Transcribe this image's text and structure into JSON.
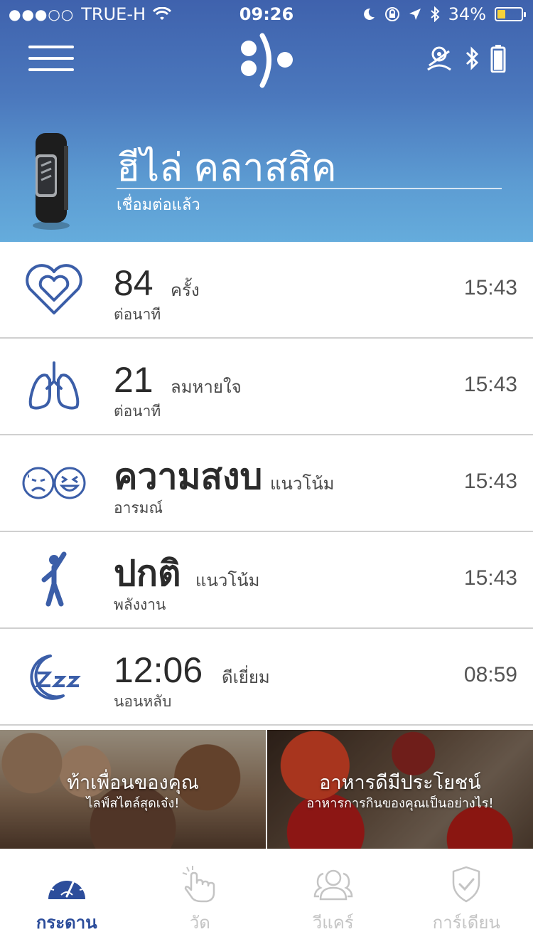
{
  "status_bar": {
    "carrier": "TRUE-H",
    "time": "09:26",
    "battery_percent": "34%",
    "battery_level": 0.34,
    "battery_color": "#f6d23a"
  },
  "header": {
    "menu_icon": "hamburger-menu-icon",
    "logo_icon": "app-logo-icon",
    "status_icons": [
      "location-pin-icon",
      "bluetooth-icon",
      "battery-icon"
    ]
  },
  "device": {
    "name": "ฮีไล่ คลาสสิค",
    "status": "เชื่อมต่อแล้ว"
  },
  "metrics": [
    {
      "icon": "heart-icon",
      "value": "84",
      "unit": "ครั้ง",
      "label": "ต่อนาที",
      "time": "15:43"
    },
    {
      "icon": "lungs-icon",
      "value": "21",
      "unit": "ลมหายใจ",
      "label": "ต่อนาที",
      "time": "15:43"
    },
    {
      "icon": "mood-faces-icon",
      "value": "ความสงบ",
      "unit": "แนวโน้ม",
      "label": "อารมณ์",
      "time": "15:43"
    },
    {
      "icon": "person-energy-icon",
      "value": "ปกติ",
      "unit": "แนวโน้ม",
      "label": "พลังงาน",
      "time": "15:43"
    },
    {
      "icon": "sleep-moon-icon",
      "value": "12:06",
      "unit": "ดีเยี่ยม",
      "label": "นอนหลับ",
      "time": "08:59"
    }
  ],
  "banners": [
    {
      "title": "ท้าเพื่อนของคุณ",
      "subtitle": "ไลฟ์สไตล์สุดเจ๋ง!"
    },
    {
      "title": "อาหารดีมีประโยชน์",
      "subtitle": "อาหารการกินของคุณเป็นอย่างไร!"
    }
  ],
  "tabs": [
    {
      "label": "กระดาน",
      "icon": "dashboard-gauge-icon",
      "active": true
    },
    {
      "label": "วัด",
      "icon": "tap-hand-icon",
      "active": false
    },
    {
      "label": "วีแคร์",
      "icon": "people-icon",
      "active": false
    },
    {
      "label": "การ์เดียน",
      "icon": "shield-check-icon",
      "active": false
    }
  ],
  "colors": {
    "primary": "#3f62ad",
    "active_tab": "#2c4d9b",
    "icon_blue": "#3b5ea8",
    "inactive": "#c4c4c4"
  }
}
